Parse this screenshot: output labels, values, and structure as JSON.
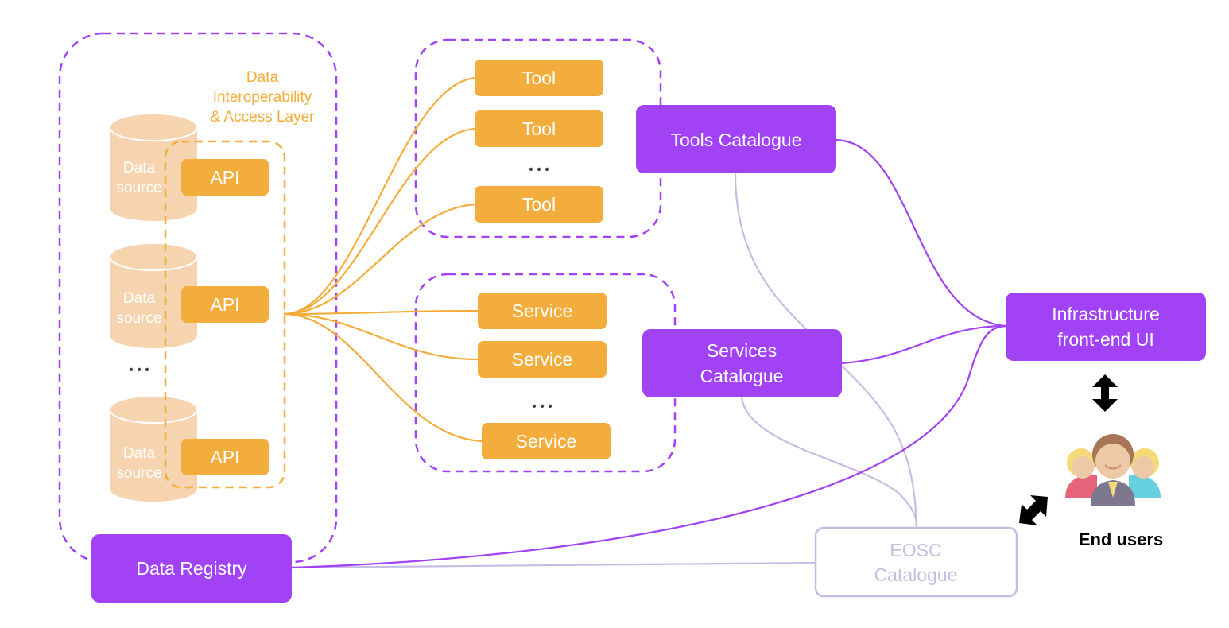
{
  "colors": {
    "orange": "#F2AD3C",
    "purple": "#A142F4",
    "light_purple": "#C7BDE3",
    "cylinder": "#F5D4AF"
  },
  "layer_label": [
    "Data",
    "Interoperability",
    "& Access Layer"
  ],
  "data_sources": [
    {
      "line1": "Data",
      "line2": "source",
      "api": "API"
    },
    {
      "line1": "Data",
      "line2": "source",
      "api": "API"
    },
    {
      "line1": "Data",
      "line2": "source",
      "api": "API"
    }
  ],
  "ellipsis": "• • •",
  "tools": [
    "Tool",
    "Tool",
    "Tool"
  ],
  "services": [
    "Service",
    "Service",
    "Service"
  ],
  "tools_catalogue": "Tools Catalogue",
  "services_catalogue": [
    "Services",
    "Catalogue"
  ],
  "infrastructure_ui": [
    "Infrastructure",
    "front-end UI"
  ],
  "data_registry": "Data Registry",
  "eosc_catalogue": [
    "EOSC",
    "Catalogue"
  ],
  "end_users": "End users",
  "icons": [
    "users-icon",
    "double-arrow-vertical-icon",
    "double-arrow-diagonal-icon",
    "database-icon"
  ]
}
